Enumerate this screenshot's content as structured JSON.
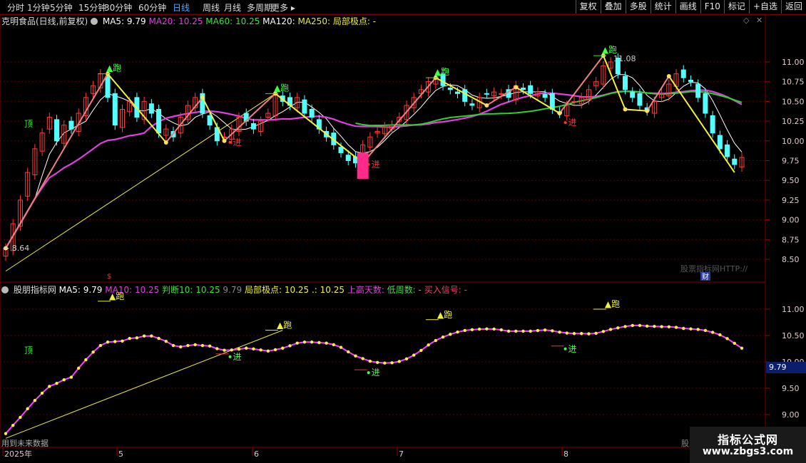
{
  "period_tabs": [
    "分时",
    "1分钟",
    "5分钟",
    "15分钟",
    "30分钟",
    "60分钟",
    "日线",
    "周线",
    "月线",
    "多周期",
    "更多 ▸"
  ],
  "active_period": "日线",
  "right_buttons": [
    "复权",
    "叠加",
    "多股",
    "统计",
    "画线",
    "F10",
    "标记",
    "+自选",
    "返回"
  ],
  "main_panel": {
    "title": "克明食品(日线,前复权)",
    "indicators": [
      {
        "label": "MA5: 9.79",
        "color": "#ffffff"
      },
      {
        "label": "MA20: 10.25",
        "color": "#e040e0"
      },
      {
        "label": "MA60: 10.25",
        "color": "#40e040"
      },
      {
        "label": "MA120:",
        "color": "#ffffff"
      },
      {
        "label": "MA250:",
        "color": "#e8e840"
      },
      {
        "label": "局部极点: -",
        "color": "#f0f040"
      }
    ],
    "y_ticks": [
      "11.00",
      "10.75",
      "10.50",
      "10.25",
      "10.00",
      "9.75",
      "9.50",
      "9.25",
      "9.00",
      "8.75",
      "8.50"
    ],
    "high_label": "11.08",
    "low_label": "8.64",
    "run_label": "▲跑",
    "buy_label": "进",
    "top_label": "顶",
    "watermark": "股票指标网HTTP://",
    "cai_label": "财"
  },
  "sub_panel": {
    "title": "股朋指标网",
    "indicators": [
      {
        "label": "MA5: 9.79",
        "color": "#ffffff"
      },
      {
        "label": "MA10: 10.25",
        "color": "#e040e0"
      },
      {
        "label": "判断10: 10.25",
        "color": "#40e040"
      },
      {
        "label": "9.79",
        "color": "#888888"
      },
      {
        "label": "局部极点: 10.25 .: 10.25",
        "color": "#f0f040"
      },
      {
        "label": "上高天数: ",
        "color": "#e040e0"
      },
      {
        "label": "低周数: -",
        "color": "#40e040"
      },
      {
        "label": "买入信号: -",
        "color": "#ff3b6b"
      }
    ],
    "y_ticks": [
      "11.00",
      "10.50",
      "10.00",
      "9.50",
      "9.00"
    ],
    "current_value": "9.79",
    "future_note": "用到未来数据",
    "watermark": "股票"
  },
  "date_axis": {
    "labels": [
      "2025年",
      "5",
      "6",
      "7",
      "8"
    ]
  },
  "logo": {
    "line1": "指标公式网",
    "line2": "www.zbgs3.com"
  },
  "colors": {
    "up": "#ff3b3b",
    "down": "#54ffff",
    "ma20": "#e040e0",
    "ma60": "#30d030",
    "zig_up": "#f08080",
    "zig_down": "#f0f040"
  },
  "chart_data": {
    "type": "candlestick",
    "closes": [
      8.64,
      8.95,
      9.25,
      9.6,
      9.9,
      10.1,
      10.3,
      10.0,
      10.2,
      10.15,
      10.35,
      10.55,
      10.7,
      10.85,
      10.55,
      10.2,
      10.4,
      10.5,
      10.3,
      10.5,
      10.35,
      10.1,
      10.15,
      10.05,
      10.3,
      10.45,
      10.55,
      10.35,
      10.2,
      10.0,
      10.05,
      10.15,
      10.3,
      10.25,
      10.15,
      10.25,
      10.35,
      10.6,
      10.5,
      10.45,
      10.55,
      10.35,
      10.3,
      10.15,
      10.05,
      9.95,
      9.85,
      9.75,
      9.72,
      9.95,
      10.05,
      10.12,
      10.18,
      10.2,
      10.3,
      10.45,
      10.55,
      10.65,
      10.75,
      10.8,
      10.7,
      10.65,
      10.6,
      10.5,
      10.45,
      10.55,
      10.6,
      10.62,
      10.6,
      10.55,
      10.7,
      10.65,
      10.6,
      10.62,
      10.55,
      10.4,
      10.35,
      10.45,
      10.5,
      10.55,
      10.65,
      10.75,
      10.95,
      11.0,
      10.85,
      10.65,
      10.55,
      10.45,
      10.38,
      10.5,
      10.6,
      10.72,
      10.85,
      10.8,
      10.75,
      10.55,
      10.35,
      10.1,
      9.9,
      9.8,
      9.7,
      9.79
    ]
  }
}
